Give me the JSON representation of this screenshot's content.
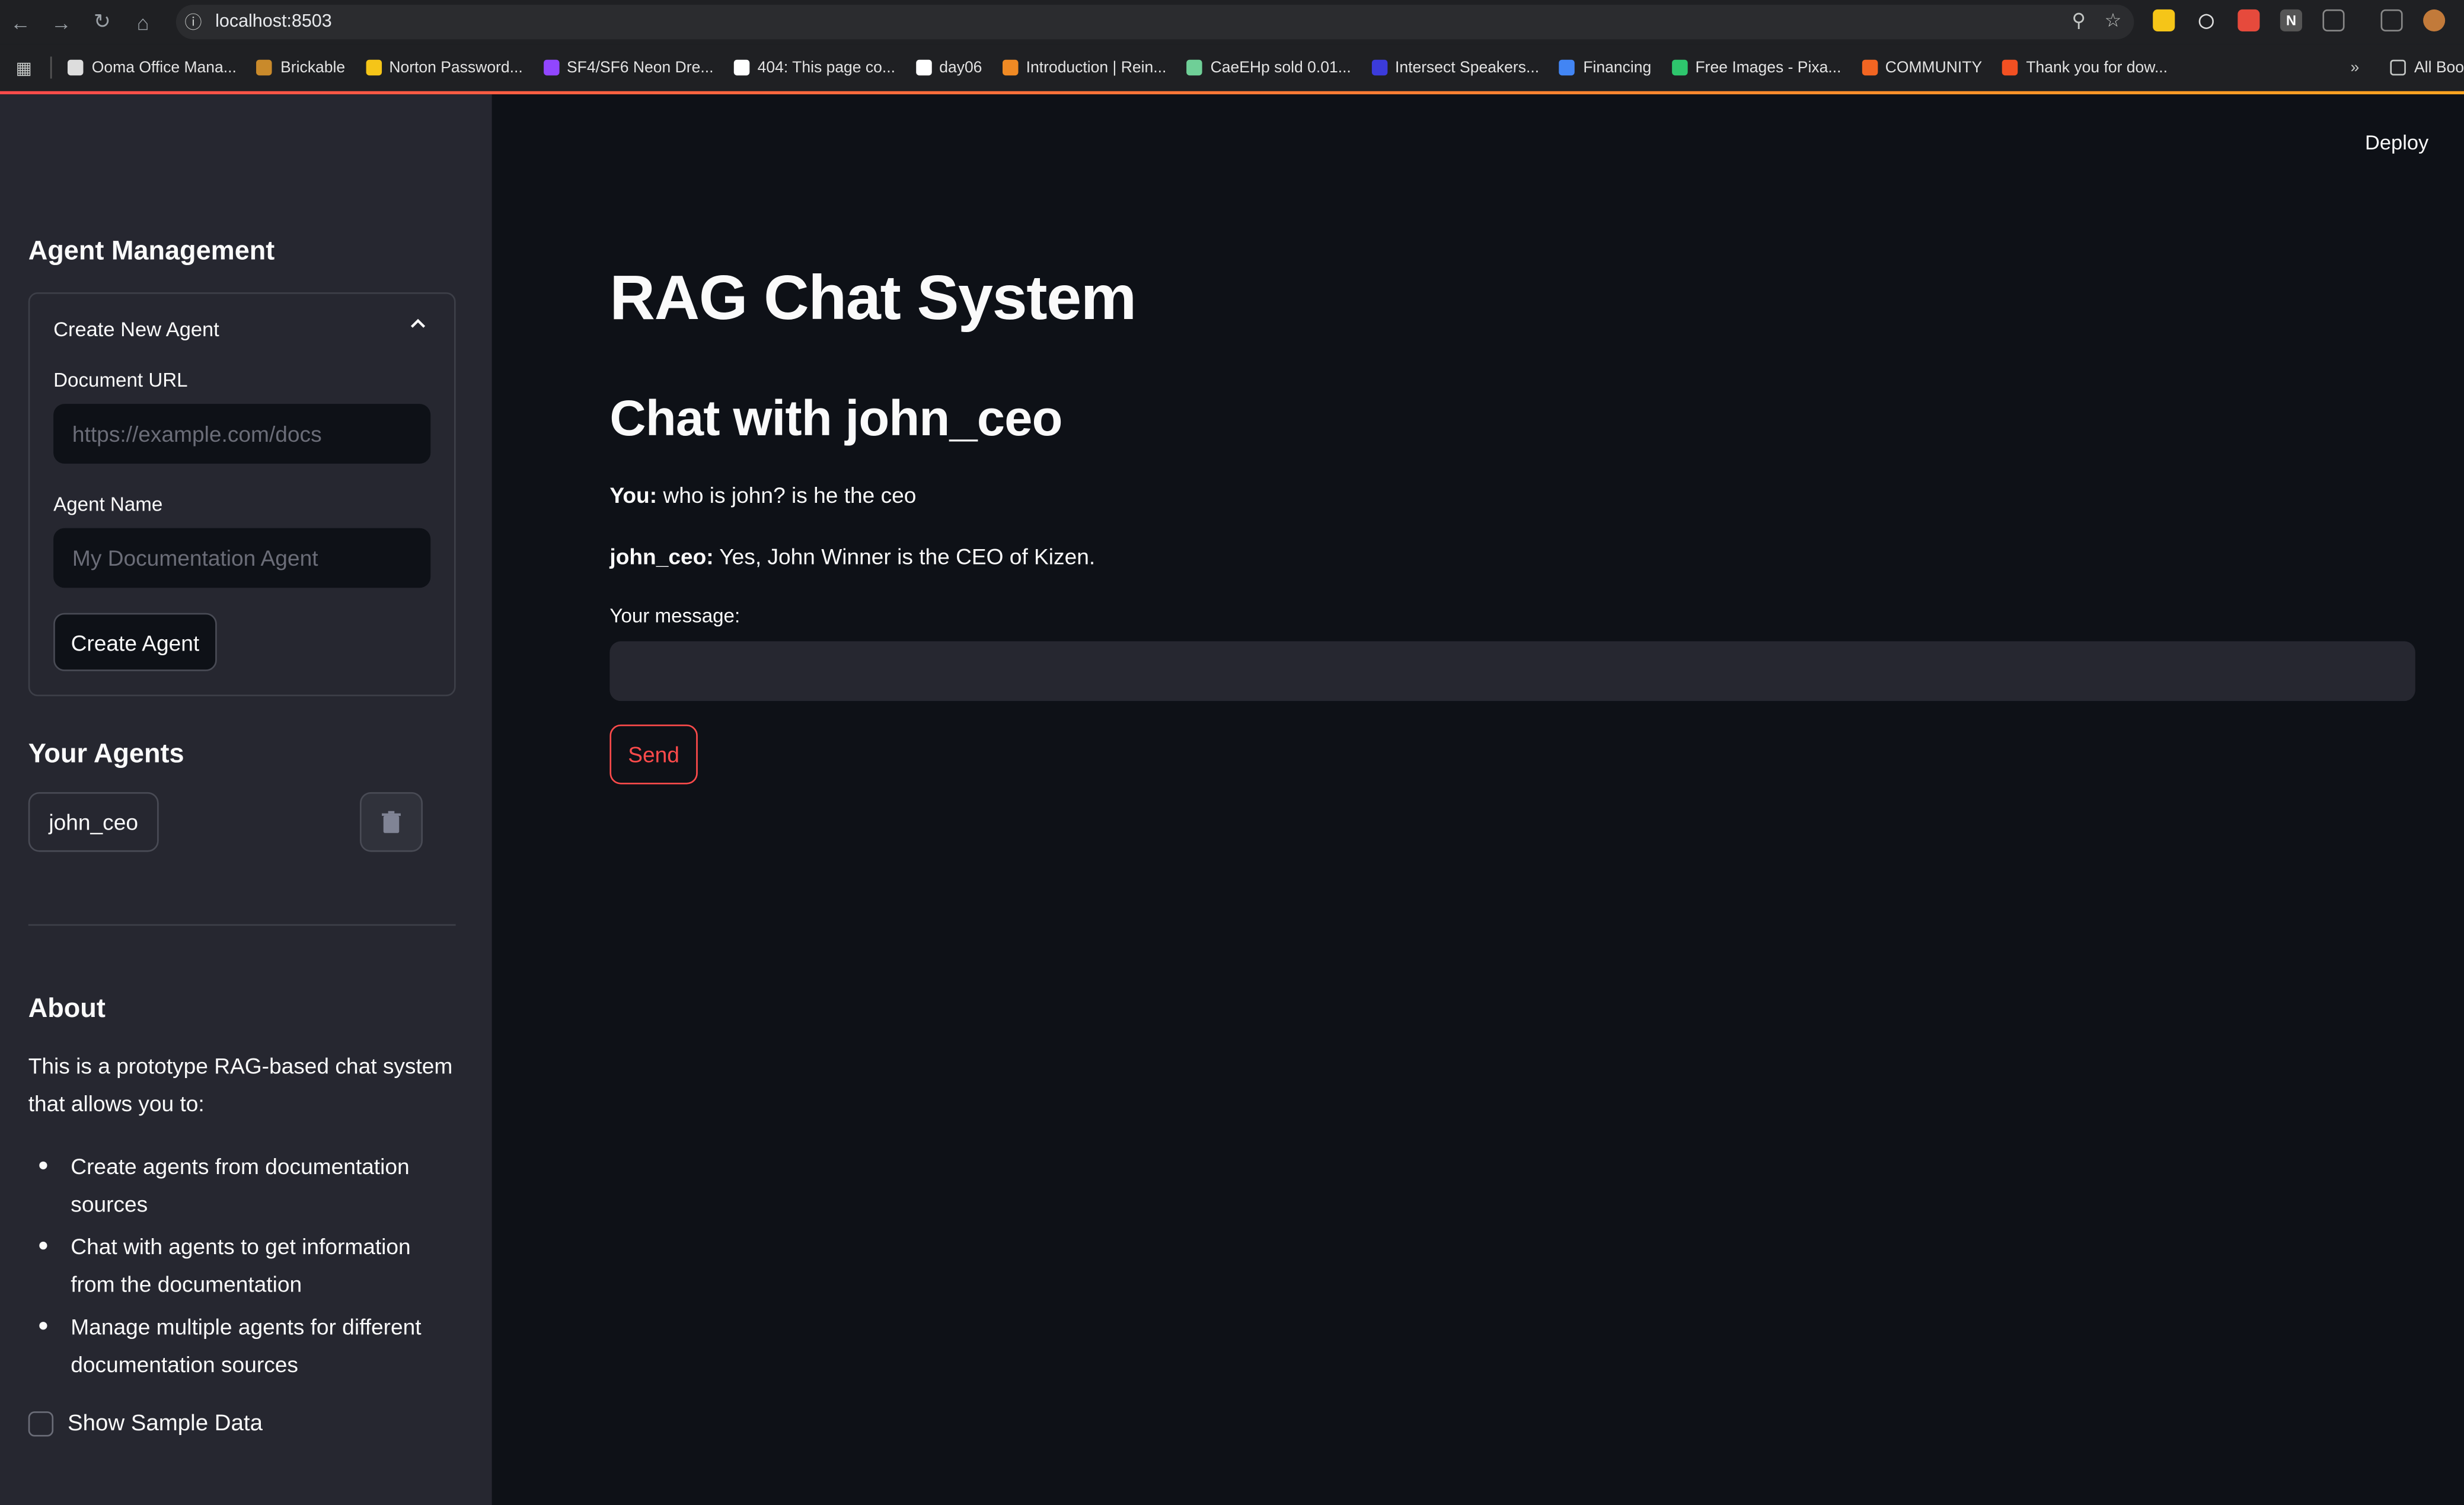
{
  "browser": {
    "url": "localhost:8503",
    "bookmarks": [
      {
        "label": "Ooma Office Mana...",
        "color": "#dddddd"
      },
      {
        "label": "Brickable",
        "color": "#c98a2b"
      },
      {
        "label": "Norton Password...",
        "color": "#f5c518"
      },
      {
        "label": "SF4/SF6 Neon Dre...",
        "color": "#9146ff"
      },
      {
        "label": "404: This page co...",
        "color": "#ffffff"
      },
      {
        "label": "day06",
        "color": "#ffffff"
      },
      {
        "label": "Introduction | Rein...",
        "color": "#f08a24"
      },
      {
        "label": "CaeEHp sold 0.01...",
        "color": "#6fcf97"
      },
      {
        "label": "Intersect Speakers...",
        "color": "#3b3bdb"
      },
      {
        "label": "Financing",
        "color": "#4285f4"
      },
      {
        "label": "Free Images - Pixa...",
        "color": "#2ec66d"
      },
      {
        "label": "COMMUNITY",
        "color": "#f26522"
      },
      {
        "label": "Thank you for dow...",
        "color": "#f25022"
      }
    ],
    "all_bookmarks_label": "All Boo"
  },
  "sidebar": {
    "heading": "Agent Management",
    "expander": {
      "title": "Create New Agent",
      "url_label": "Document URL",
      "url_placeholder": "https://example.com/docs",
      "name_label": "Agent Name",
      "name_placeholder": "My Documentation Agent",
      "create_label": "Create Agent"
    },
    "agents_heading": "Your Agents",
    "agents": [
      "john_ceo"
    ],
    "about_heading": "About",
    "about_text": "This is a prototype RAG-based chat system that allows you to:",
    "about_items": [
      "Create agents from documentation sources",
      "Chat with agents to get information from the documentation",
      "Manage multiple agents for different documentation sources"
    ],
    "sample_data_label": "Show Sample Data"
  },
  "main": {
    "deploy_label": "Deploy",
    "title": "RAG Chat System",
    "chat_title": "Chat with john_ceo",
    "messages": [
      {
        "speaker": "You:",
        "text": "who is john? is he the ceo"
      },
      {
        "speaker": "john_ceo:",
        "text": "Yes, John Winner is the CEO of Kizen."
      }
    ],
    "input_label": "Your message:",
    "input_value": "",
    "send_label": "Send"
  },
  "colors": {
    "background": "#0e1117",
    "sidebar": "#262730",
    "accent": "#ff4b4b"
  }
}
